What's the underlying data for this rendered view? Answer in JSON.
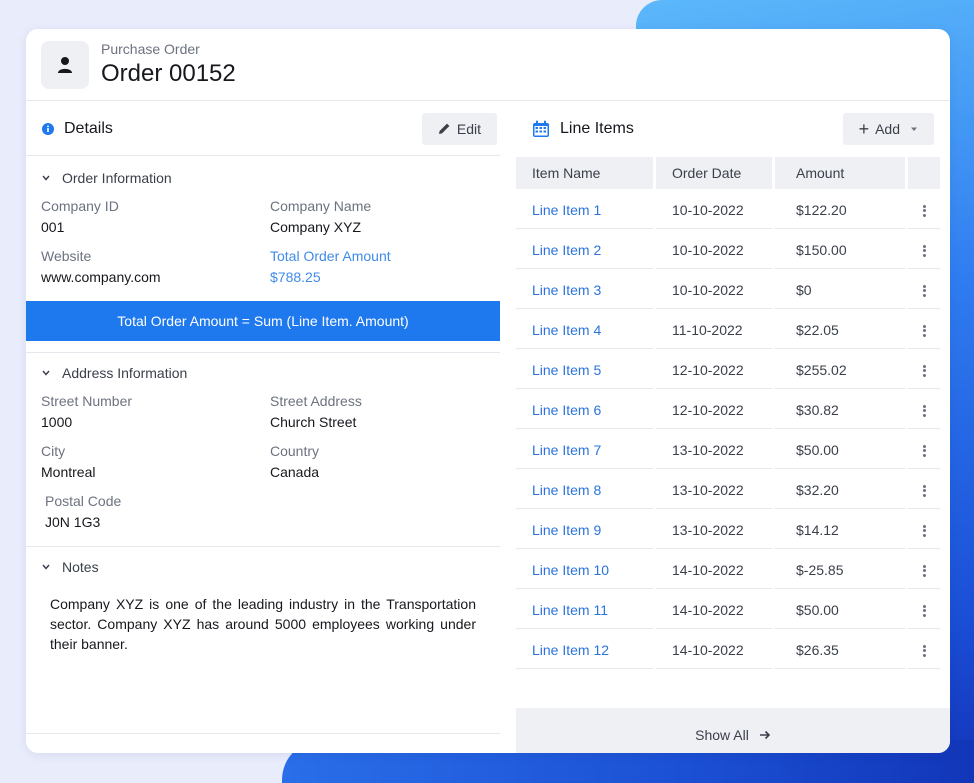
{
  "header": {
    "subtitle": "Purchase Order",
    "title": "Order 00152"
  },
  "details": {
    "title": "Details",
    "edit_label": "Edit",
    "order_info": {
      "heading": "Order Information",
      "company_id_label": "Company ID",
      "company_id": "001",
      "company_name_label": "Company Name",
      "company_name": "Company XYZ",
      "website_label": "Website",
      "website": "www.company.com",
      "total_label": "Total Order Amount",
      "total": "$788.25",
      "formula": "Total Order Amount = Sum (Line Item. Amount)"
    },
    "address_info": {
      "heading": "Address Information",
      "street_number_label": "Street Number",
      "street_number": "1000",
      "street_address_label": "Street Address",
      "street_address": "Church Street",
      "city_label": "City",
      "city": "Montreal",
      "country_label": "Country",
      "country": "Canada",
      "postal_code_label": "Postal Code",
      "postal_code": "J0N 1G3"
    },
    "notes": {
      "heading": "Notes",
      "text": "Company XYZ is one of the leading industry in the Transportation sector. Company XYZ has around 5000 employees working under their banner."
    }
  },
  "line_items": {
    "title": "Line Items",
    "add_label": "Add",
    "columns": [
      "Item Name",
      "Order Date",
      "Amount"
    ],
    "rows": [
      {
        "name": "Line Item 1",
        "date": "10-10-2022",
        "amount": "$122.20"
      },
      {
        "name": "Line Item 2",
        "date": "10-10-2022",
        "amount": "$150.00"
      },
      {
        "name": "Line Item 3",
        "date": "10-10-2022",
        "amount": "$0"
      },
      {
        "name": "Line Item 4",
        "date": "11-10-2022",
        "amount": "$22.05"
      },
      {
        "name": "Line Item 5",
        "date": "12-10-2022",
        "amount": "$255.02"
      },
      {
        "name": "Line Item 6",
        "date": "12-10-2022",
        "amount": "$30.82"
      },
      {
        "name": "Line Item 7",
        "date": "13-10-2022",
        "amount": "$50.00"
      },
      {
        "name": "Line Item 8",
        "date": "13-10-2022",
        "amount": "$32.20"
      },
      {
        "name": "Line Item 9",
        "date": "13-10-2022",
        "amount": "$14.12"
      },
      {
        "name": "Line Item 10",
        "date": "14-10-2022",
        "amount": "$-25.85"
      },
      {
        "name": "Line Item 11",
        "date": "14-10-2022",
        "amount": "$50.00"
      },
      {
        "name": "Line Item 12",
        "date": "14-10-2022",
        "amount": "$26.35"
      }
    ],
    "show_all_label": "Show All"
  },
  "colors": {
    "accent": "#1e78ee",
    "link": "#2b74db",
    "total_accent": "#3f8bea",
    "panel_bg": "#eef0f4"
  }
}
